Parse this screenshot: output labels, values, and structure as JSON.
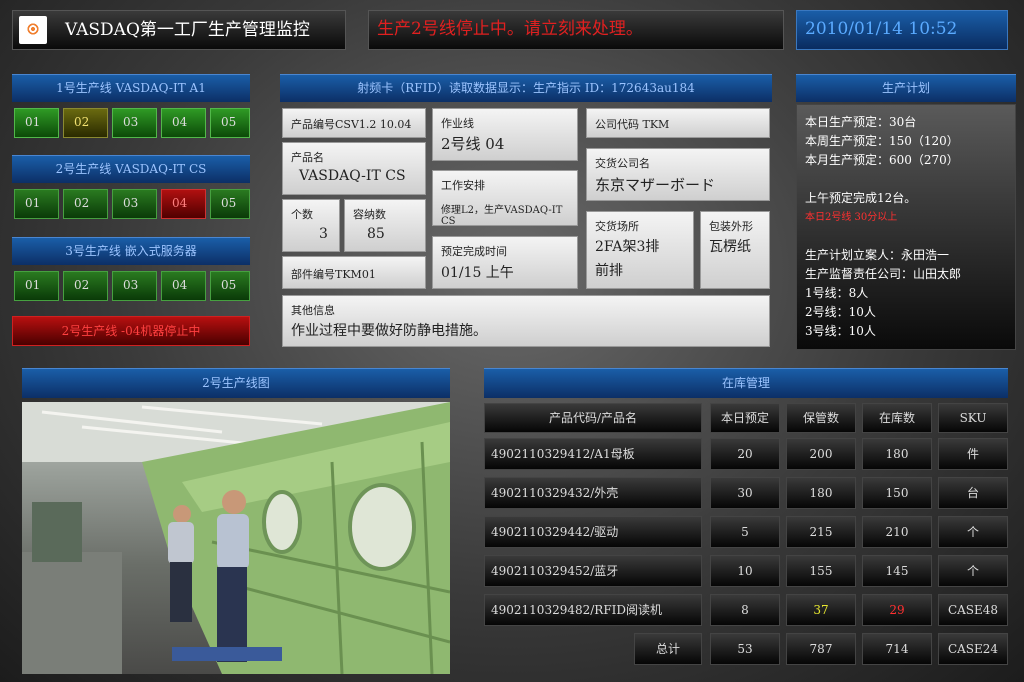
{
  "header": {
    "title": "VASDAQ第一工厂生产管理监控",
    "alert": "生产2号线停止中。请立刻来处理。",
    "datetime": "2010/01/14 10:52"
  },
  "lines": [
    {
      "title": "1号生产线 VASDAQ-IT A1",
      "cells": [
        "01",
        "02",
        "03",
        "04",
        "05"
      ]
    },
    {
      "title": "2号生产线 VASDAQ-IT CS",
      "cells": [
        "01",
        "02",
        "03",
        "04",
        "05"
      ]
    },
    {
      "title": "3号生产线 嵌入式服务器",
      "cells": [
        "01",
        "02",
        "03",
        "04",
        "05"
      ]
    }
  ],
  "status_bar": "2号生产线 -04机器停止中",
  "rfid": {
    "header": "射频卡（RFID）读取数据显示：生产指示  ID：172643au184",
    "product_code": "产品编号CSV1.2 10.04",
    "product_name_label": "产品名",
    "product_name": "VASDAQ-IT CS",
    "count_label": "个数",
    "count": "3",
    "capacity_label": "容纳数",
    "capacity": "85",
    "part_no": "部件编号TKM01",
    "work_line_label": "作业线",
    "work_line": "2号线 04",
    "work_plan_label": "工作安排",
    "work_plan": "修理L2，生产VASDAQ-IT  CS",
    "due_label": "预定完成时间",
    "due": "01/15 上午",
    "company_code": "公司代码 TKM",
    "delivery_company_label": "交货公司名",
    "delivery_company": "东京マザーボード",
    "delivery_place_label": "交货场所",
    "delivery_place_1": "2FA架3排",
    "delivery_place_2": "前排",
    "package_label": "包装外形",
    "package": "瓦楞纸",
    "other_label": "其他信息",
    "other": "作业过程中要做好防静电措施。"
  },
  "plan": {
    "header": "生产计划",
    "lines": [
      "本日生产预定：30台",
      "本周生产预定：150（120）",
      "本月生产预定：600（270）"
    ],
    "am_done": "上午预定完成12台。",
    "warning": "本日2号线 30分以上",
    "people": [
      "生产计划立案人：永田浩一",
      "生产监督责任公司：山田太郎",
      "1号线：8人",
      "2号线：10人",
      "3号线：10人"
    ]
  },
  "photo_header": "2号生产线图",
  "inventory": {
    "header": "在库管理",
    "columns": [
      "产品代码/产品名",
      "本日预定",
      "保管数",
      "在库数",
      "SKU"
    ],
    "rows": [
      [
        "4902110329412/A1母板",
        "20",
        "200",
        "180",
        "件"
      ],
      [
        "4902110329432/外壳",
        "30",
        "180",
        "150",
        "台"
      ],
      [
        "4902110329442/驱动",
        "5",
        "215",
        "210",
        "个"
      ],
      [
        "4902110329452/蓝牙",
        "10",
        "155",
        "145",
        "个"
      ],
      [
        "4902110329482/RFID阅读机",
        "8",
        "37",
        "29",
        "CASE48"
      ]
    ],
    "total_label": "总计",
    "totals": [
      "53",
      "787",
      "714",
      "CASE24"
    ]
  },
  "colors": {
    "alert_red": "#e02020",
    "datetime_blue": "#4a9cff",
    "header_blue": "#1a5ea8",
    "highlight_yellow": "#e8e830",
    "highlight_red": "#ff3030"
  }
}
